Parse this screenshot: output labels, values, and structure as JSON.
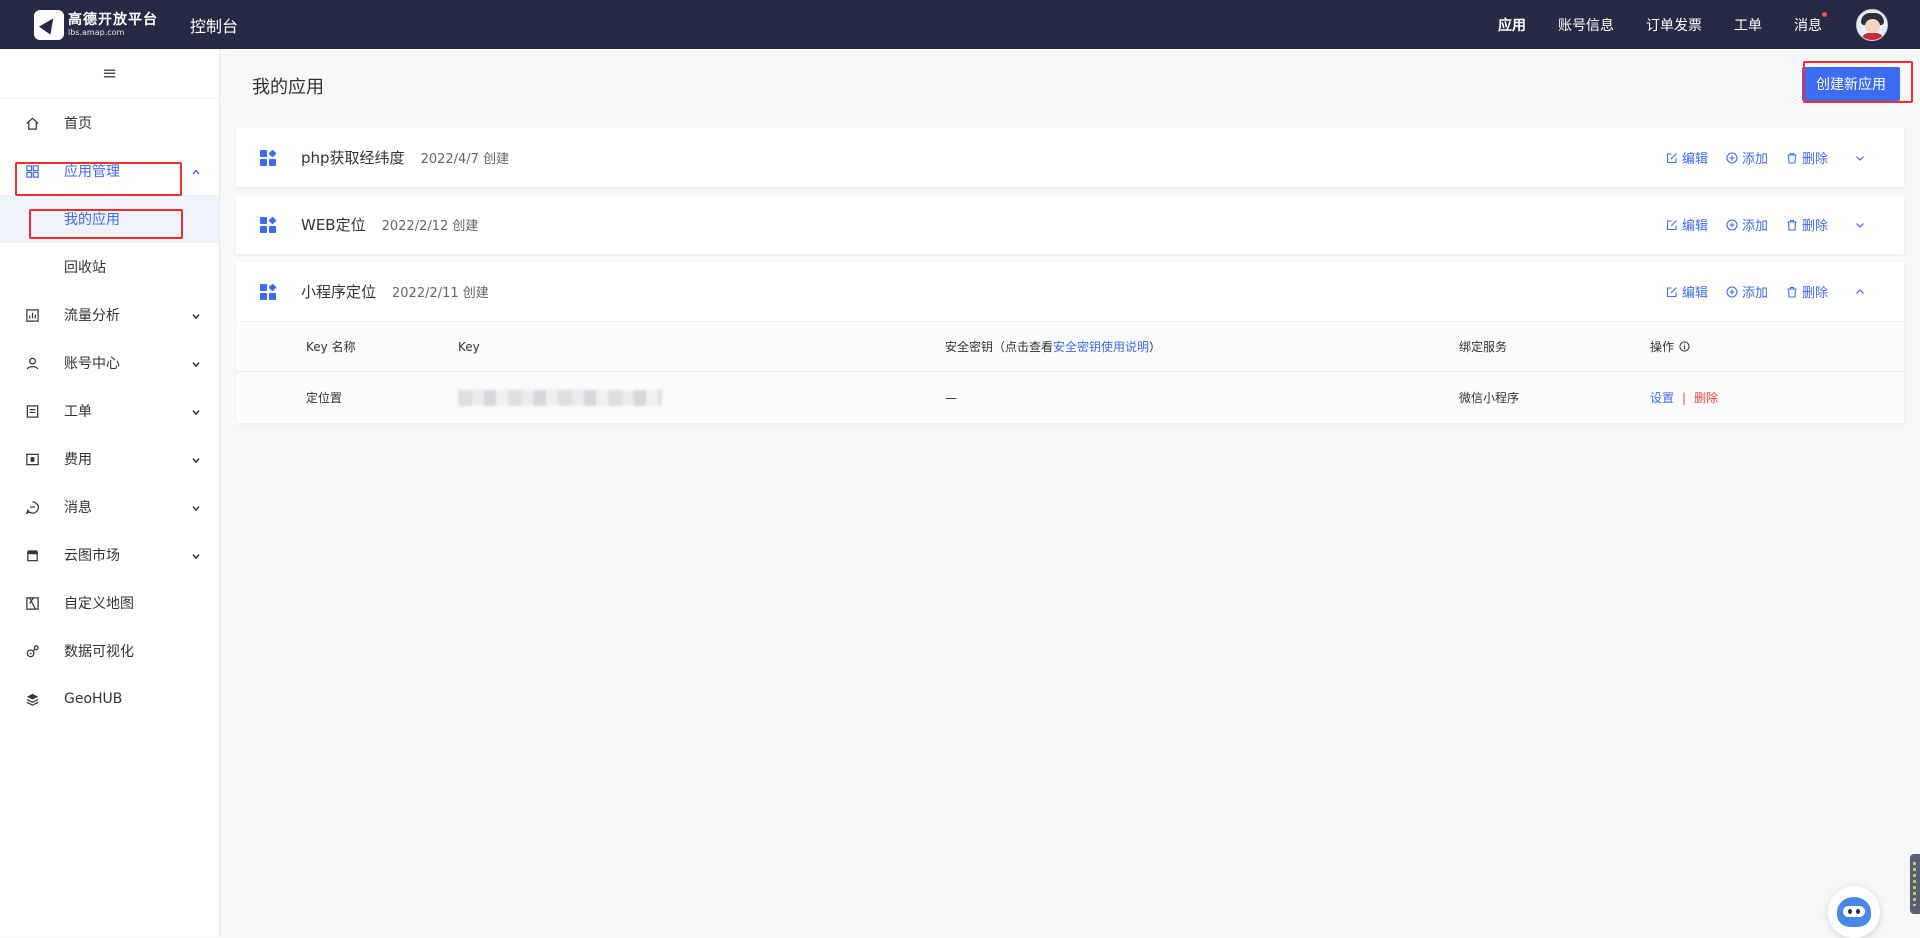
{
  "topbar": {
    "logo_cn": "高德开放平台",
    "logo_en": "lbs.amap.com",
    "console": "控制台",
    "nav": [
      {
        "label": "应用"
      },
      {
        "label": "账号信息"
      },
      {
        "label": "订单发票"
      },
      {
        "label": "工单"
      },
      {
        "label": "消息"
      }
    ]
  },
  "sidebar": {
    "collapse": "≡",
    "home": "首页",
    "app_mgmt": "应用管理",
    "my_apps": "我的应用",
    "recycle": "回收站",
    "traffic": "流量分析",
    "account": "账号中心",
    "ticket": "工单",
    "fees": "费用",
    "messages": "消息",
    "market": "云图市场",
    "custom_map": "自定义地图",
    "data_vis": "数据可视化",
    "geohub": "GeoHUB"
  },
  "main": {
    "title": "我的应用",
    "create_btn": "创建新应用",
    "actions": {
      "edit": "编辑",
      "add": "添加",
      "delete": "删除"
    },
    "apps": [
      {
        "name": "php获取经纬度",
        "date": "2022/4/7 创建"
      },
      {
        "name": "WEB定位",
        "date": "2022/2/12 创建"
      },
      {
        "name": "小程序定位",
        "date": "2022/2/11 创建"
      }
    ],
    "key_table": {
      "h_name": "Key 名称",
      "h_key": "Key",
      "h_secret_prefix": "安全密钥（点击查看",
      "h_secret_link": "安全密钥使用说明",
      "h_secret_suffix": "）",
      "h_service": "绑定服务",
      "h_ops": "操作",
      "row": {
        "name": "定位置",
        "secret": "—",
        "service": "微信小程序",
        "settings": "设置",
        "sep": "|",
        "delete": "删除"
      }
    }
  },
  "colors": {
    "primary": "#3c6cf2",
    "topbar": "#262a44",
    "danger": "#f5453e",
    "highlight": "#f52a2a"
  }
}
